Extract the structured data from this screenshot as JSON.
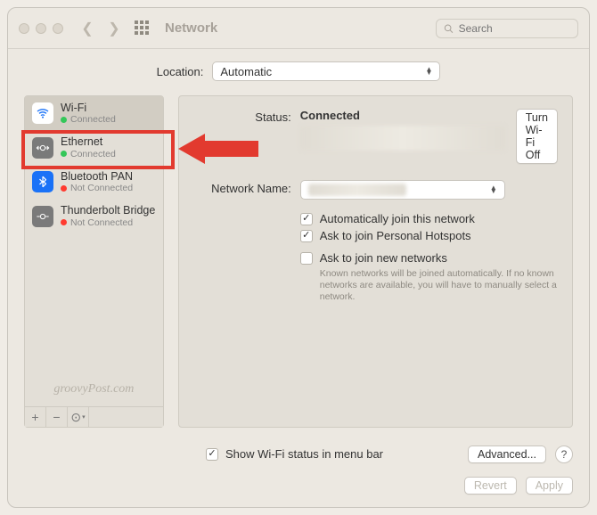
{
  "window_title": "Network",
  "search_placeholder": "Search",
  "location": {
    "label": "Location:",
    "value": "Automatic"
  },
  "sidebar": {
    "items": [
      {
        "name": "Wi-Fi",
        "status": "Connected",
        "dot": "green",
        "icon": "wifi"
      },
      {
        "name": "Ethernet",
        "status": "Connected",
        "dot": "green",
        "icon": "eth"
      },
      {
        "name": "Bluetooth PAN",
        "status": "Not Connected",
        "dot": "red",
        "icon": "bt"
      },
      {
        "name": "Thunderbolt Bridge",
        "status": "Not Connected",
        "dot": "red",
        "icon": "tb"
      }
    ]
  },
  "watermark": "groovyPost.com",
  "detail": {
    "status_label": "Status:",
    "status_value": "Connected",
    "turn_off": "Turn Wi-Fi Off",
    "network_name_label": "Network Name:",
    "auto_join": "Automatically join this network",
    "ask_hotspots": "Ask to join Personal Hotspots",
    "ask_new": "Ask to join new networks",
    "ask_new_help": "Known networks will be joined automatically. If no known networks are available, you will have to manually select a network."
  },
  "show_status": "Show Wi-Fi status in menu bar",
  "advanced": "Advanced...",
  "footer": {
    "revert": "Revert",
    "apply": "Apply"
  },
  "highlight_color": "#e23a2f"
}
